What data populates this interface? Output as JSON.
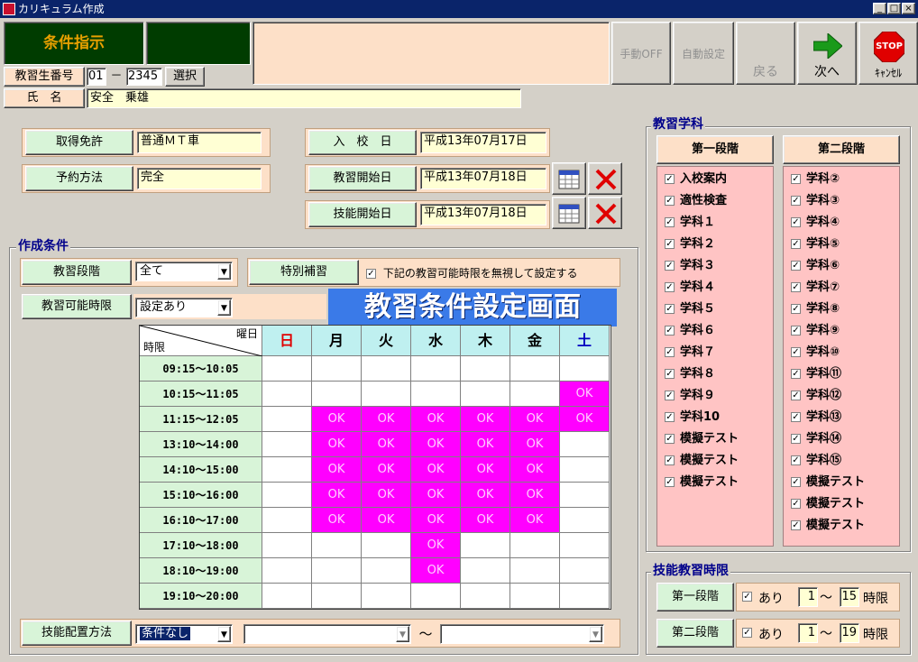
{
  "window": {
    "title": "カリキュラム作成",
    "min": "_",
    "max": "□",
    "close": "×"
  },
  "header": {
    "instruction_label": "条件指示",
    "buttons": {
      "manual_off": "手動OFF",
      "auto_set": "自動設定",
      "back": "戻る",
      "next": "次へ",
      "cancel": "ｷｬﾝｾﾙ",
      "stop": "STOP"
    }
  },
  "student": {
    "number_label": "教習生番号",
    "number_part1": "01",
    "separator": "－",
    "number_part2": "2345",
    "select_button": "選択",
    "name_label": "氏　名",
    "name_value": "安全　乗雄"
  },
  "info": {
    "license_label": "取得免許",
    "license_value": "普通ＭＴ車",
    "reserve_label": "予約方法",
    "reserve_value": "完全",
    "enroll_label": "入　校　日",
    "enroll_value": "平成13年07月17日",
    "training_start_label": "教習開始日",
    "training_start_value": "平成13年07月18日",
    "skill_start_label": "技能開始日",
    "skill_start_value": "平成13年07月18日"
  },
  "conditions": {
    "group_title": "作成条件",
    "stage_label": "教習段階",
    "stage_value": "全て",
    "special_label": "特別補習",
    "ignore_checked": true,
    "ignore_text": "下記の教習可能時限を無視して設定する",
    "available_label": "教習可能時限",
    "available_value": "設定あり",
    "banner": "教習条件設定画面",
    "placement_label": "技能配置方法",
    "placement_value": "条件なし",
    "range_sep": "～"
  },
  "grid": {
    "corner_day": "曜日",
    "corner_period": "時限",
    "days": [
      "日",
      "月",
      "火",
      "水",
      "木",
      "金",
      "土"
    ],
    "day_colors": [
      "#e00000",
      "#000000",
      "#000000",
      "#000000",
      "#000000",
      "#000000",
      "#0000c0"
    ],
    "ok_text": "OK",
    "periods": [
      "09:15～10:05",
      "10:15～11:05",
      "11:15～12:05",
      "13:10～14:00",
      "14:10～15:00",
      "15:10～16:00",
      "16:10～17:00",
      "17:10～18:00",
      "18:10～19:00",
      "19:10～20:00"
    ],
    "cells": [
      [
        0,
        0,
        0,
        0,
        0,
        0,
        0
      ],
      [
        0,
        0,
        0,
        0,
        0,
        0,
        1
      ],
      [
        0,
        1,
        1,
        1,
        1,
        1,
        1
      ],
      [
        0,
        1,
        1,
        1,
        1,
        1,
        0
      ],
      [
        0,
        1,
        1,
        1,
        1,
        1,
        0
      ],
      [
        0,
        1,
        1,
        1,
        1,
        1,
        0
      ],
      [
        0,
        1,
        1,
        1,
        1,
        1,
        0
      ],
      [
        0,
        0,
        0,
        1,
        0,
        0,
        0
      ],
      [
        0,
        0,
        0,
        1,
        0,
        0,
        0
      ],
      [
        0,
        0,
        0,
        0,
        0,
        0,
        0
      ]
    ]
  },
  "subjects": {
    "group_title": "教習学科",
    "stage1_title": "第一段階",
    "stage2_title": "第二段階",
    "stage1": [
      "入校案内",
      "適性検査",
      "学科１",
      "学科２",
      "学科３",
      "学科４",
      "学科５",
      "学科６",
      "学科７",
      "学科８",
      "学科９",
      "学科10",
      "模擬テスト",
      "模擬テスト",
      "模擬テスト"
    ],
    "stage2": [
      "学科②",
      "学科③",
      "学科④",
      "学科⑤",
      "学科⑥",
      "学科⑦",
      "学科⑧",
      "学科⑨",
      "学科⑩",
      "学科⑪",
      "学科⑫",
      "学科⑬",
      "学科⑭",
      "学科⑮",
      "模擬テスト",
      "模擬テスト",
      "模擬テスト"
    ]
  },
  "skill_hours": {
    "group_title": "技能教習時限",
    "stage1_label": "第一段階",
    "stage2_label": "第二段階",
    "has_label": "あり",
    "stage1_from": "1",
    "stage1_to": "15",
    "stage2_from": "1",
    "stage2_to": "19",
    "sep": "～",
    "unit": "時限"
  }
}
